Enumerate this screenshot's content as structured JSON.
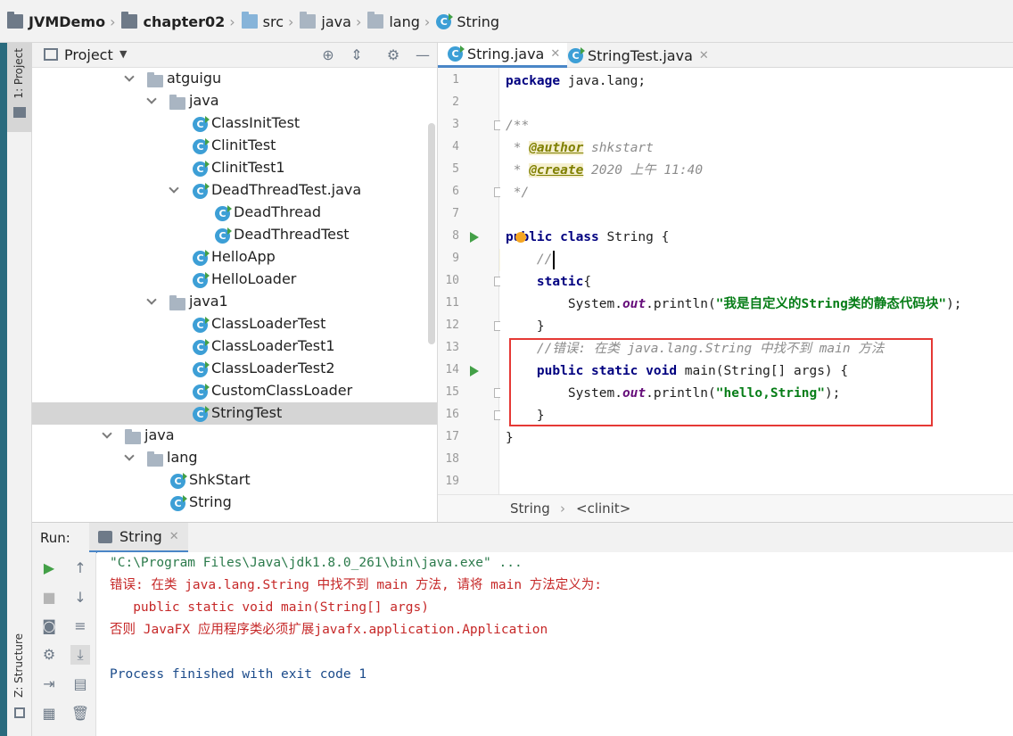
{
  "breadcrumb": {
    "items": [
      {
        "label": "JVMDemo",
        "icon": "project-folder-icon"
      },
      {
        "label": "chapter02",
        "icon": "module-folder-icon"
      },
      {
        "label": "src",
        "icon": "source-folder-icon"
      },
      {
        "label": "java",
        "icon": "folder-icon"
      },
      {
        "label": "lang",
        "icon": "folder-icon"
      },
      {
        "label": "String",
        "icon": "class-icon"
      }
    ]
  },
  "sidebar_left": {
    "project_tab": "1: Project",
    "structure_tab": "Z: Structure"
  },
  "project_panel": {
    "title": "Project",
    "tree": [
      {
        "label": "atguigu",
        "type": "package",
        "expanded": true
      },
      {
        "label": "java",
        "type": "package",
        "expanded": true
      },
      {
        "label": "ClassInitTest",
        "type": "class"
      },
      {
        "label": "ClinitTest",
        "type": "class"
      },
      {
        "label": "ClinitTest1",
        "type": "class"
      },
      {
        "label": "DeadThreadTest.java",
        "type": "file",
        "expanded": true
      },
      {
        "label": "DeadThread",
        "type": "class"
      },
      {
        "label": "DeadThreadTest",
        "type": "class"
      },
      {
        "label": "HelloApp",
        "type": "class"
      },
      {
        "label": "HelloLoader",
        "type": "class"
      },
      {
        "label": "java1",
        "type": "package",
        "expanded": true
      },
      {
        "label": "ClassLoaderTest",
        "type": "class"
      },
      {
        "label": "ClassLoaderTest1",
        "type": "class"
      },
      {
        "label": "ClassLoaderTest2",
        "type": "class"
      },
      {
        "label": "CustomClassLoader",
        "type": "class"
      },
      {
        "label": "StringTest",
        "type": "class",
        "selected": true
      },
      {
        "label": "java",
        "type": "package",
        "expanded": true
      },
      {
        "label": "lang",
        "type": "package",
        "expanded": true
      },
      {
        "label": "ShkStart",
        "type": "class"
      },
      {
        "label": "String",
        "type": "class"
      }
    ]
  },
  "editor": {
    "tabs": [
      {
        "label": "String.java",
        "active": true
      },
      {
        "label": "StringTest.java",
        "active": false
      }
    ],
    "line_numbers": [
      "1",
      "2",
      "3",
      "4",
      "5",
      "6",
      "7",
      "8",
      "9",
      "10",
      "11",
      "12",
      "13",
      "14",
      "15",
      "16",
      "17",
      "18",
      "19"
    ],
    "code": {
      "l1_kw": "package",
      "l1_rest": " java.lang;",
      "l3": "/**",
      "l4_pre": " * ",
      "l4_tag": "@author",
      "l4_rest": " shkstart",
      "l5_pre": " * ",
      "l5_tag": "@create",
      "l5_rest": " 2020 上午 11:40",
      "l6": " */",
      "l8_kw": "public class",
      "l8_rest": " String {",
      "l9": "    //",
      "l10_kw": "static",
      "l10_rest": "{",
      "l11_a": "        System.",
      "l11_fld": "out",
      "l11_b": ".println(",
      "l11_str": "\"我是自定义的String类的静态代码块\"",
      "l11_c": ");",
      "l12": "    }",
      "l13": "    //错误: 在类 java.lang.String 中找不到 main 方法",
      "l14_kw": "public static void",
      "l14_rest": " main(String[] args) {",
      "l15_a": "        System.",
      "l15_fld": "out",
      "l15_b": ".println(",
      "l15_str": "\"hello,String\"",
      "l15_c": ");",
      "l16": "    }",
      "l17": "}"
    },
    "bottom_breadcrumb": [
      "String",
      "<clinit>"
    ]
  },
  "run_panel": {
    "label": "Run:",
    "tab": "String",
    "console_lines": [
      {
        "text": "\"C:\\Program Files\\Java\\jdk1.8.0_261\\bin\\java.exe\" ...",
        "color": "#2b7a4b"
      },
      {
        "text": "错误: 在类 java.lang.String 中找不到 main 方法, 请将 main 方法定义为:",
        "color": "#c62828"
      },
      {
        "text": "   public static void main(String[] args)",
        "color": "#c62828"
      },
      {
        "text": "否则 JavaFX 应用程序类必须扩展javafx.application.Application",
        "color": "#c62828"
      },
      {
        "text": "",
        "color": "#000000"
      },
      {
        "text": "Process finished with exit code 1",
        "color": "#1a4a8a"
      }
    ]
  },
  "colors": {
    "accent_tab": "#4a86c7",
    "highlight_box": "#e53935",
    "run_green": "#43a047"
  }
}
